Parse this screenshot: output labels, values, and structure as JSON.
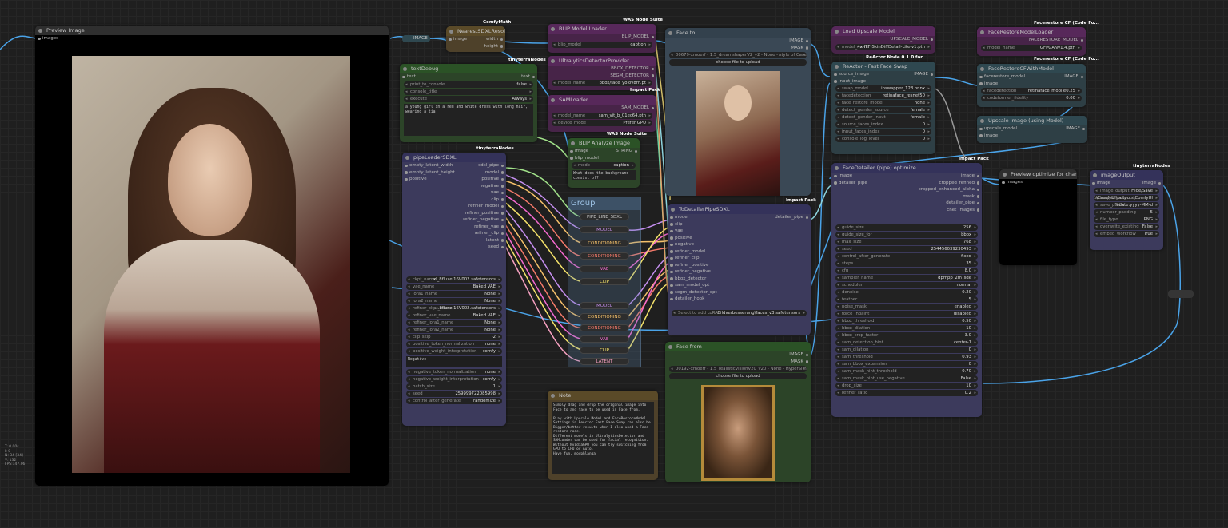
{
  "preview": {
    "title": "Preview Image",
    "input": "images"
  },
  "nearest": {
    "badge": "ComfyMath",
    "title": "NearestSDXLResolution",
    "in": "image",
    "out1": "width",
    "out2": "height"
  },
  "imagepill": "IMAGE",
  "textdebug": {
    "badge": "tinyterraNodes",
    "title": "textDebug",
    "in": "text",
    "out": "text",
    "w": [
      [
        "print_to_console",
        "false"
      ],
      [
        "console_title",
        ""
      ],
      [
        "execute",
        "Always"
      ]
    ],
    "text": "a young girl in a red and white dress with long hair, wearing a tia"
  },
  "pipeloader": {
    "badge": "tinyterraNodes",
    "title": "pipeLoaderSDXL",
    "inputs": [
      "empty_latent_width",
      "empty_latent_height",
      "positive"
    ],
    "outputs": [
      "sdxl_pipe",
      "model",
      "positive",
      "negative",
      "vae",
      "clip",
      "refiner_model",
      "refiner_positive",
      "refiner_negative",
      "refiner_vae",
      "refiner_clip",
      "latent",
      "seed"
    ],
    "w": [
      [
        "ckpt_name",
        "...xl_8fluxel16V002.safetensors"
      ],
      [
        "vae_name",
        "Baked VAE"
      ],
      [
        "lora1_name",
        "None"
      ],
      [
        "lora2_name",
        "None"
      ],
      [
        "refiner_ckpt_name",
        "...8fluxel16V002.safetensors"
      ],
      [
        "refiner_vae_name",
        "Baked VAE"
      ],
      [
        "refiner_lora1_name",
        "None"
      ],
      [
        "refiner_lora2_name",
        "None"
      ],
      [
        "clip_skip",
        "-2"
      ],
      [
        "positive_token_normalization",
        "none"
      ],
      [
        "positive_weight_interpretation",
        "comfy"
      ]
    ],
    "neg": "Negative",
    "w2": [
      [
        "negative_token_normalization",
        "none"
      ],
      [
        "negative_weight_interpretation",
        "comfy"
      ],
      [
        "batch_size",
        "1"
      ],
      [
        "seed",
        "259999722085998"
      ],
      [
        "control_after_generate",
        "randomize"
      ]
    ]
  },
  "blipload": {
    "badge": "WAS Node Suite",
    "title": "BLIP Model Loader",
    "out": "BLIP_MODEL",
    "w": [
      [
        "blip_model",
        "caption"
      ]
    ]
  },
  "ultra": {
    "title": "UltralyticsDetectorProvider",
    "out1": "BBOX_DETECTOR",
    "out2": "SEGM_DETECTOR",
    "w": [
      [
        "model_name",
        "bbox/face_yolov8m.pt"
      ]
    ],
    "badge": "Impact Pack"
  },
  "sam": {
    "title": "SAMLoader",
    "out": "SAM_MODEL",
    "w": [
      [
        "model_name",
        "sam_vit_b_01ec64.pth"
      ],
      [
        "device_mode",
        "Prefer GPU"
      ]
    ],
    "badge": "WAS Node Suite"
  },
  "blipanalyze": {
    "title": "BLIP Analyze Image",
    "in1": "image",
    "in2": "blip_model",
    "out": "STRING",
    "w": [
      [
        "mode",
        "caption"
      ]
    ],
    "q": "What does the background consist of?"
  },
  "group": {
    "title": "Group",
    "pills": [
      "PIPE_LINE_SDXL",
      "MODEL",
      "CONDITIONING",
      "CONDITIONING",
      "VAE",
      "CLIP",
      "MODEL",
      "CONDITIONING",
      "CONDITIONING",
      "VAE",
      "CLIP",
      "LATENT"
    ]
  },
  "faceto": {
    "title": "Face to",
    "out1": "IMAGE",
    "out2": "MASK",
    "file": "00679-xmoerf - 1.5_dreamshaperV2_v2 - None - style of Casey Baugh style of Pino Daeni An incredibly.jpg",
    "btn": "choose file to upload",
    "badge": "Impact Pack"
  },
  "todetailer": {
    "title": "ToDetailerPipeSDXL",
    "out": "detailer_pipe",
    "inputs": [
      "model",
      "clip",
      "vae",
      "positive",
      "negative",
      "refiner_model",
      "refiner_clip",
      "refiner_positive",
      "refiner_negative",
      "bbox_detector",
      "sam_model_opt",
      "segm_detector_opt",
      "detailer_hook"
    ],
    "w": [
      [
        "Select to add LoRA",
        "Bildverbesserung\\faces_v3.safetensors"
      ]
    ]
  },
  "facefrom": {
    "title": "Face from",
    "out1": "IMAGE",
    "out2": "MASK",
    "file": "00192-xmoerf - 1.5_realisticVisionV20_v20 - None - HyperSimp...award winning portrait photo of an young gold woman (1).jpg",
    "btn": "choose file to upload"
  },
  "note": {
    "title": "Note",
    "text": "Simply drag and drop the original image into Face to and face to be used in Face from.\n\nPlay with Upscale Model and FaceRestoreModel Settings in ReActor Fast Face Swap can also be Bigger/better results when I also used a Face restore node.\nDifferent models in UltralyticsDetector and SAMLoader can be used for facial recognition.\nWithout NvidiaGPU you can try switching from GPU to CPU or Auto.\nHave fun, morphlanga"
  },
  "upscaleload": {
    "title": "Load Upscale Model",
    "out": "UPSCALE_MODEL",
    "w": [
      [
        "model_name",
        "4x-ITF-SkinDiffDetail-Lite-v1.pth"
      ]
    ],
    "badge": "ReActor Node 0.1.0 for..."
  },
  "reactor": {
    "title": "ReActor - Fast Face Swap",
    "in1": "source_image",
    "in2": "input_image",
    "out": "IMAGE",
    "w": [
      [
        "swap_model",
        "inswapper_128.onnx"
      ],
      [
        "facedetection",
        "retinaface_resnet50"
      ],
      [
        "face_restore_model",
        "none"
      ],
      [
        "detect_gender_source",
        "female"
      ],
      [
        "detect_gender_input",
        "female"
      ],
      [
        "source_faces_index",
        "0"
      ],
      [
        "input_faces_index",
        "0"
      ],
      [
        "console_log_level",
        "0"
      ]
    ],
    "badge": "Impact Pack"
  },
  "facedetailer": {
    "title": "FaceDetailer (pipe) optimize",
    "in1": "image",
    "in2": "detailer_pipe",
    "outs": [
      "image",
      "cropped_refined",
      "cropped_enhanced_alpha",
      "mask",
      "detailer_pipe",
      "cnet_images"
    ],
    "w": [
      [
        "guide_size",
        "256"
      ],
      [
        "guide_size_for",
        "bbox"
      ],
      [
        "max_size",
        "768"
      ],
      [
        "seed",
        "254456039230493"
      ],
      [
        "control_after_generate",
        "fixed"
      ],
      [
        "steps",
        "35"
      ],
      [
        "cfg",
        "8.0"
      ],
      [
        "sampler_name",
        "dpmpp_2m_sde"
      ],
      [
        "scheduler",
        "normal"
      ],
      [
        "denoise",
        "0.20"
      ],
      [
        "feather",
        "5"
      ],
      [
        "noise_mask",
        "enabled"
      ],
      [
        "force_inpaint",
        "disabled"
      ],
      [
        "bbox_threshold",
        "0.50"
      ],
      [
        "bbox_dilation",
        "10"
      ],
      [
        "bbox_crop_factor",
        "3.0"
      ],
      [
        "sam_detection_hint",
        "center-1"
      ],
      [
        "sam_dilation",
        "0"
      ],
      [
        "sam_threshold",
        "0.93"
      ],
      [
        "sam_bbox_expansion",
        "0"
      ],
      [
        "sam_mask_hint_threshold",
        "0.70"
      ],
      [
        "sam_mask_hint_use_negative",
        "False"
      ],
      [
        "drop_size",
        "10"
      ],
      [
        "refiner_ratio",
        "0.2"
      ]
    ]
  },
  "frloader": {
    "badge": "Facerestore CF (Code Fo...",
    "title": "FaceRestoreModelLoader",
    "out": "FACERESTORE_MODEL",
    "w": [
      [
        "model_name",
        "GFPGANv1.4.pth"
      ]
    ]
  },
  "frcf": {
    "badge": "Facerestore CF (Code Fo...",
    "title": "FaceRestoreCFWithModel",
    "in1": "facerestore_model",
    "in2": "image",
    "out": "IMAGE",
    "w": [
      [
        "facedetection",
        "retinaface_mobile0.25"
      ],
      [
        "codeformer_fidelity",
        "0.00"
      ]
    ]
  },
  "upscaleimg": {
    "title": "Upscale Image (using Model)",
    "in1": "upscale_model",
    "in2": "image",
    "out": "IMAGE"
  },
  "prevopt": {
    "title": "Preview optimize for change",
    "in": "images"
  },
  "imgout": {
    "badge": "tinyterraNodes",
    "title": "imageOutput",
    "in": "image",
    "out": "image",
    "w": [
      [
        "image_output",
        "Hide/Save"
      ],
      [
        "output_path",
        "C:\\ComfyUI\\outputs\\ComfyUI"
      ],
      [
        "save_prefix",
        "%date:yyyy-MM-d"
      ],
      [
        "number_padding",
        "5"
      ],
      [
        "file_type",
        "PNG"
      ],
      [
        "overwrite_existing",
        "False"
      ],
      [
        "embed_workflow",
        "True"
      ]
    ]
  },
  "hud": [
    "T: 0.00s",
    "I: 0",
    "N: 34 [34]",
    "V: 132",
    "FPS:147.06"
  ],
  "colors": {
    "accent_link": "#4aa3e8"
  }
}
